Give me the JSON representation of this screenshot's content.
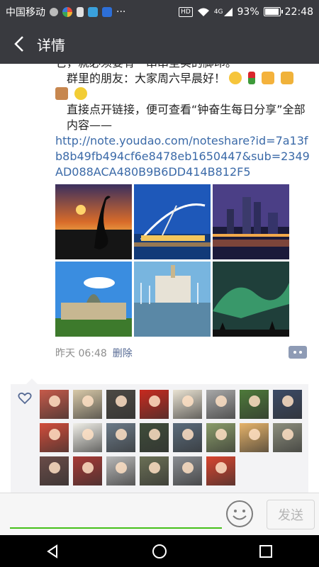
{
  "status_bar": {
    "carrier": "中国移动",
    "hd": "HD",
    "network": "4G",
    "battery_percent": "93%",
    "battery_level": 0.93,
    "time": "22:48",
    "more": "···"
  },
  "header": {
    "title": "详情"
  },
  "post": {
    "line_top": "它，就必须要有一串串坚实的脚印。",
    "greeting": "群里的朋友：大家周六早晨好！",
    "instruction": "直接点开链接，便可查看“钟奋生每日分享”全部内容——",
    "link": "http://note.youdao.com/noteshare?id=7a13fb8b49fb494cf6e8478eb1650447&sub=2349AD088ACA480B9B6DD414B812F5",
    "photos": [
      {
        "name": "sunset-heron-photo"
      },
      {
        "name": "white-bridge-photo"
      },
      {
        "name": "city-skyline-night-photo"
      },
      {
        "name": "castle-hill-photo"
      },
      {
        "name": "harbor-building-photo"
      },
      {
        "name": "aurora-photo"
      }
    ],
    "time": "昨天 06:48",
    "delete_label": "删除"
  },
  "comment_bar": {
    "placeholder": "",
    "send_label": "发送"
  },
  "colors": {
    "header_bg": "#393a3f",
    "link": "#3b6aa8",
    "accent_green": "#45c01a",
    "meta_blue": "#576b95"
  }
}
